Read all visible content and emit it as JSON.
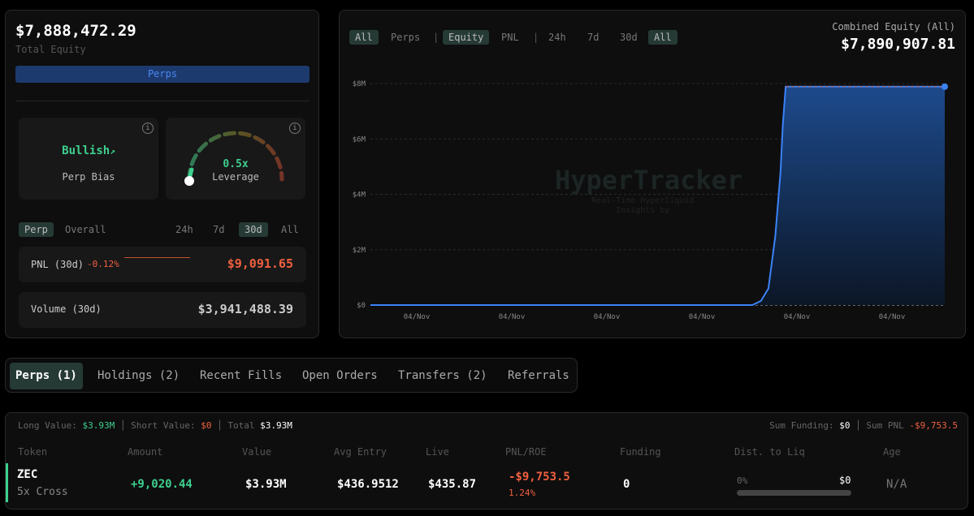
{
  "summary": {
    "total_equity": "$7,888,472.29",
    "total_equity_label": "Total Equity",
    "perps_button": "Perps"
  },
  "bias": {
    "value": "Bullish",
    "label": "Perp Bias",
    "info": "i"
  },
  "leverage": {
    "value": "0.5x",
    "label": "Leverage",
    "fraction": 0.05,
    "info": "i"
  },
  "stats_tabs": {
    "scope": [
      "Perp",
      "Overall"
    ],
    "periods": [
      "24h",
      "7d",
      "30d",
      "All"
    ],
    "active_scope": "Perp",
    "active_period": "30d"
  },
  "pnl": {
    "label": "PNL (30d)",
    "pct": "-0.12%",
    "value": "$9,091.65"
  },
  "volume": {
    "label": "Volume (30d)",
    "value": "$3,941,488.39"
  },
  "chart_header": {
    "filters1": [
      "All",
      "Perps"
    ],
    "filters2": [
      "Equity",
      "PNL"
    ],
    "periods": [
      "24h",
      "7d",
      "30d",
      "All"
    ],
    "sep": "|",
    "combined_label": "Combined Equity (All)",
    "combined_value": "$7,890,907.81",
    "watermark": "HyperTracker",
    "watermark_sub1": "Real-Time Hyperliquid",
    "watermark_sub2": "Insights by"
  },
  "chart_data": {
    "type": "area",
    "title": "Combined Equity (All)",
    "ylim": [
      0,
      8000000
    ],
    "yticks": [
      "$0",
      "$2M",
      "$4M",
      "$6M",
      "$8M"
    ],
    "xticks": [
      "04/Nov",
      "04/Nov",
      "04/Nov",
      "04/Nov",
      "04/Nov",
      "04/Nov"
    ],
    "x": [
      0,
      0.6,
      0.665,
      0.68,
      0.693,
      0.705,
      0.714,
      0.718,
      0.723,
      1
    ],
    "values": [
      0,
      0,
      0,
      150000,
      600000,
      2500000,
      4800000,
      6500000,
      7890000,
      7890000
    ],
    "series_color": "#3b82f6"
  },
  "tabs": [
    {
      "label": "Perps (1)"
    },
    {
      "label": "Holdings (2)"
    },
    {
      "label": "Recent Fills"
    },
    {
      "label": "Open Orders"
    },
    {
      "label": "Transfers (2)"
    },
    {
      "label": "Referrals"
    }
  ],
  "table": {
    "summary": {
      "long_label": "Long Value:",
      "long": "$3.93M",
      "short_label": "Short Value:",
      "short": "$0",
      "total_label": "Total",
      "total": "$3.93M",
      "funding_label": "Sum Funding:",
      "funding": "$0",
      "pnl_label": "Sum PNL",
      "pnl": "-$9,753.5"
    },
    "headers": [
      "Token",
      "Amount",
      "Value",
      "Avg Entry",
      "Live",
      "PNL/ROE",
      "Funding",
      "Dist. to Liq",
      "Age"
    ],
    "row": {
      "token": "ZEC",
      "mode": "5x Cross",
      "amount": "+9,020.44",
      "value": "$3.93M",
      "avg_entry": "$436.9512",
      "live": "$435.87",
      "pnl": "-$9,753.5",
      "roe": "1.24%",
      "funding": "0",
      "liq_pct": "0%",
      "liq_value": "$0",
      "age": "N/A"
    }
  }
}
